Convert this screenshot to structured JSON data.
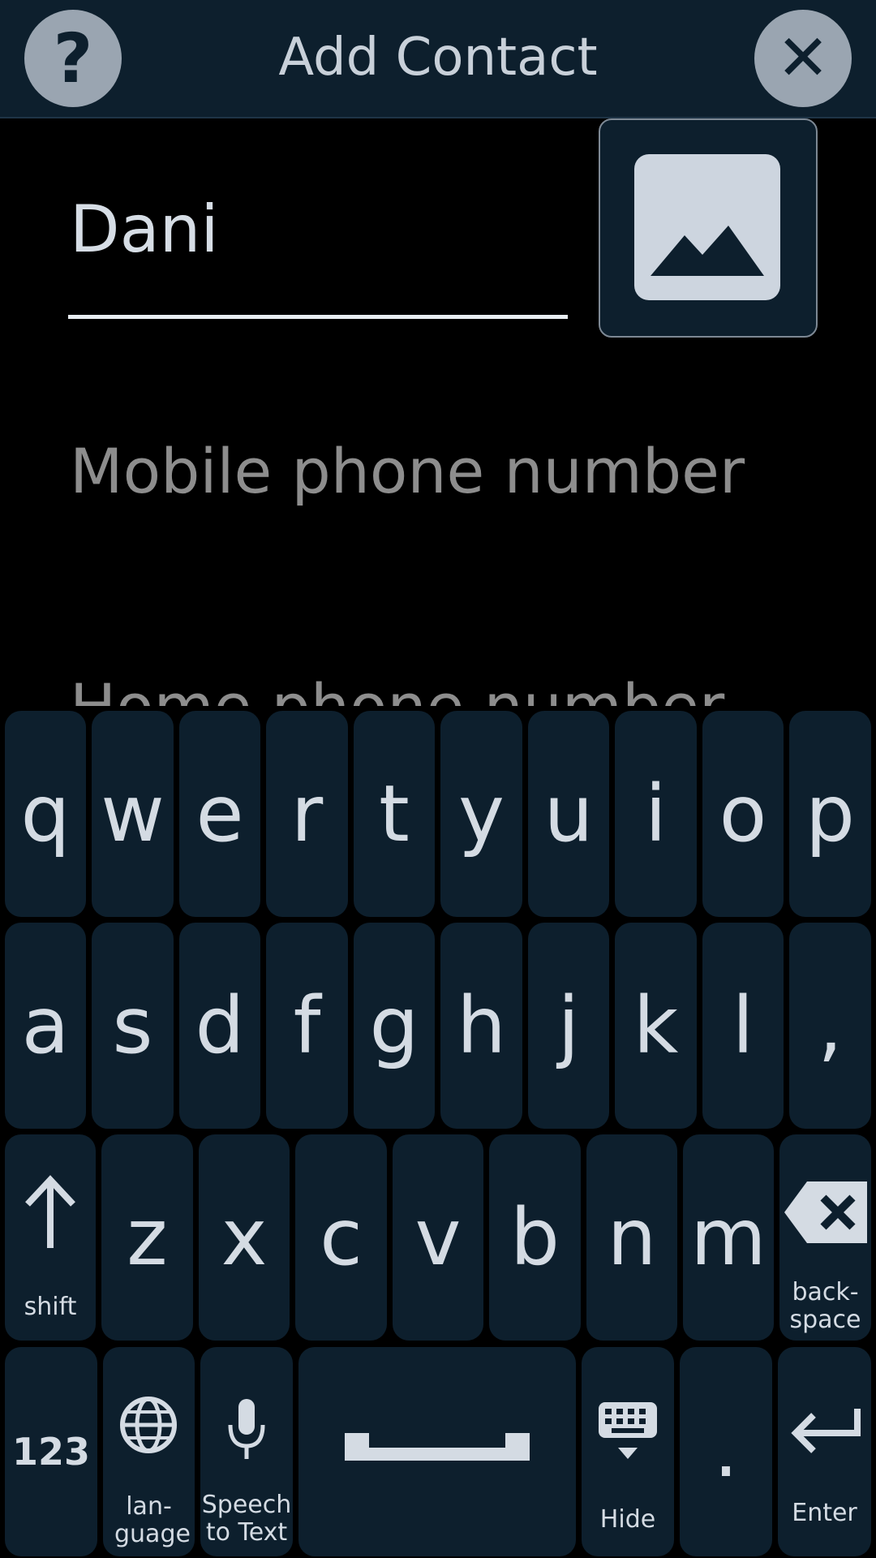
{
  "header": {
    "title": "Add Contact",
    "help_label": "?",
    "close_label": "✕"
  },
  "form": {
    "name_value": "Dani",
    "mobile_placeholder": "Mobile phone number",
    "home_placeholder": "Home phone number"
  },
  "keyboard": {
    "row1": [
      "q",
      "w",
      "e",
      "r",
      "t",
      "y",
      "u",
      "i",
      "o",
      "p"
    ],
    "row2": [
      "a",
      "s",
      "d",
      "f",
      "g",
      "h",
      "j",
      "k",
      "l",
      ","
    ],
    "row3": [
      "z",
      "x",
      "c",
      "v",
      "b",
      "n",
      "m"
    ],
    "shift_label": "shift",
    "backspace_label": "back-space",
    "numbers_label": "123",
    "language_label": "lan-guage",
    "speech_label": "Speech to Text",
    "hide_label": "Hide",
    "period_label": ".",
    "enter_label": "Enter"
  },
  "colors": {
    "background": "#000000",
    "panel": "#0d1f2d",
    "key_text": "#d4dbe3",
    "placeholder": "#8d8d8d"
  }
}
